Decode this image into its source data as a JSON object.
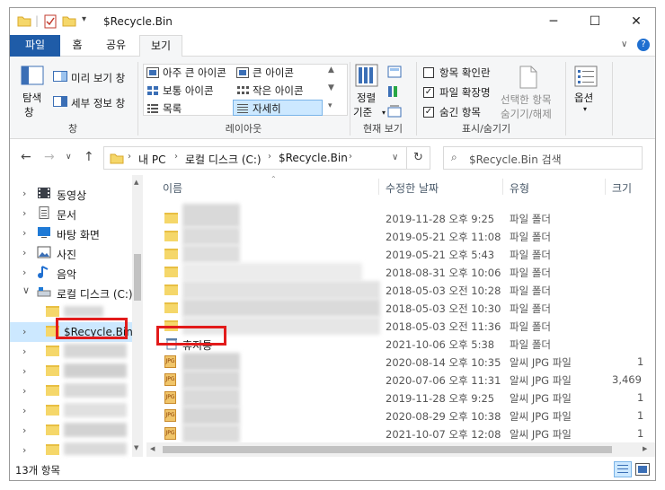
{
  "window": {
    "title": "$Recycle.Bin",
    "controls": {
      "minimize": "─",
      "maximize": "☐",
      "close": "✕"
    }
  },
  "ribbon_tabs": [
    "파일",
    "홈",
    "공유",
    "보기"
  ],
  "ribbon": {
    "pane": {
      "nav_pane": "탐색",
      "nav_pane2": "창",
      "preview": "미리 보기 창",
      "details": "세부 정보 창",
      "group": "창"
    },
    "layout": {
      "items": [
        "아주 큰 아이콘",
        "큰 아이콘",
        "보통 아이콘",
        "작은 아이콘",
        "목록",
        "자세히"
      ],
      "group": "레이아웃"
    },
    "current_view": {
      "sort_by": "정렬",
      "sort_by2": "기준",
      "group": "현재 보기"
    },
    "show_hide": {
      "item_checkboxes": "항목 확인란",
      "file_extensions": "파일 확장명",
      "hidden_items": "숨긴 항목",
      "hide_selected": "선택한 항목",
      "hide_selected2": "숨기기/해제",
      "group": "표시/숨기기"
    },
    "options": "옵션"
  },
  "address": {
    "breadcrumb": [
      "내 PC",
      "로컬 디스크 (C:)",
      "$Recycle.Bin"
    ],
    "search_placeholder": "$Recycle.Bin 검색"
  },
  "nav_tree": [
    {
      "label": "동영상",
      "icon": "video-icon"
    },
    {
      "label": "문서",
      "icon": "document-icon"
    },
    {
      "label": "바탕 화면",
      "icon": "desktop-icon"
    },
    {
      "label": "사진",
      "icon": "picture-icon"
    },
    {
      "label": "음악",
      "icon": "music-icon"
    },
    {
      "label": "로컬 디스크 (C:)",
      "icon": "drive-icon"
    },
    {
      "label": "$Recycle.Bin",
      "icon": "folder-icon"
    }
  ],
  "columns": {
    "name": "이름",
    "date": "수정한 날짜",
    "type": "유형",
    "size": "크기"
  },
  "files": [
    {
      "name": "",
      "date": "2019-11-28 오후 9:25",
      "type": "파일 폴더",
      "size": ""
    },
    {
      "name": "",
      "date": "2019-05-21 오후 11:08",
      "type": "파일 폴더",
      "size": ""
    },
    {
      "name": "",
      "date": "2019-05-21 오후 5:43",
      "type": "파일 폴더",
      "size": ""
    },
    {
      "name": "",
      "date": "2018-08-31 오후 10:06",
      "type": "파일 폴더",
      "size": ""
    },
    {
      "name": "",
      "date": "2018-05-03 오전 10:28",
      "type": "파일 폴더",
      "size": ""
    },
    {
      "name": "",
      "date": "2018-05-03 오전 10:30",
      "type": "파일 폴더",
      "size": ""
    },
    {
      "name": "",
      "date": "2018-05-03 오전 11:36",
      "type": "파일 폴더",
      "size": ""
    },
    {
      "name": "휴지통",
      "date": "2021-10-06 오후 5:38",
      "type": "파일 폴더",
      "size": ""
    },
    {
      "name": "",
      "date": "2020-08-14 오후 10:35",
      "type": "알씨 JPG 파일",
      "size": "1"
    },
    {
      "name": "",
      "date": "2020-07-06 오후 11:31",
      "type": "알씨 JPG 파일",
      "size": "3,469"
    },
    {
      "name": "",
      "date": "2019-11-28 오후 9:25",
      "type": "알씨 JPG 파일",
      "size": "1"
    },
    {
      "name": "",
      "date": "2020-08-29 오후 10:38",
      "type": "알씨 JPG 파일",
      "size": "1"
    },
    {
      "name": "",
      "date": "2021-10-07 오후 12:08",
      "type": "알씨 JPG 파일",
      "size": "1"
    }
  ],
  "status": {
    "count": "13개 항목"
  },
  "colors": {
    "accent": "#1f5ca8",
    "highlight": "#e21b1b",
    "selected": "#cce8ff"
  }
}
